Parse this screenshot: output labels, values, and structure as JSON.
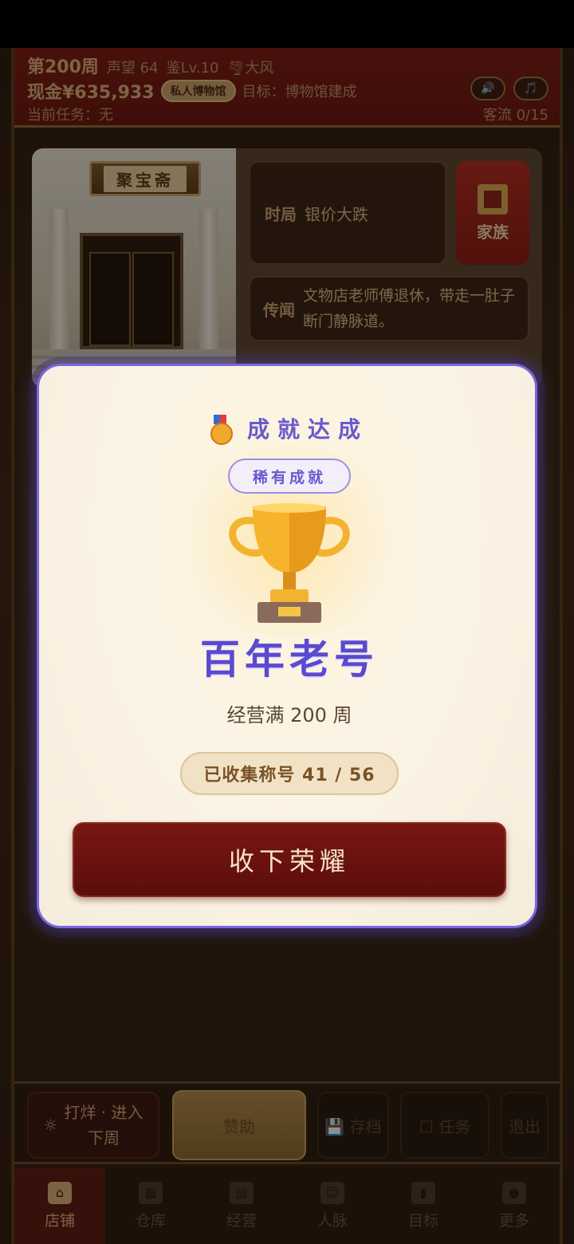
{
  "header": {
    "week": "第200周",
    "prestige": "声望 64",
    "appraisal_level": "鉴Lv.10",
    "weather": "🌪大风",
    "cash": "现金¥635,933",
    "badge": "私人博物馆",
    "goal": "目标：博物馆建成",
    "current_task": "当前任务：无",
    "visitors": "客流 0/15",
    "sound_icon": "🔊",
    "music_icon": "🎵"
  },
  "scene": {
    "shop_sign": "聚宝斋",
    "situation_key": "时局",
    "situation_value": "银价大跌",
    "rumor_key": "传闻",
    "rumor_value": "文物店老师傅退休，带走一肚子断门静脉道。",
    "family_label": "家族"
  },
  "modal": {
    "title": "成就达成",
    "rarity": "稀有成就",
    "achievement_name": "百年老号",
    "achievement_desc": "经营满 200 周",
    "collection_progress": "已收集称号 41 / 56",
    "confirm_label": "收下荣耀"
  },
  "actions": {
    "close_shop_line1": "打烊 · 进入",
    "close_shop_line2": "下周",
    "sponsor": "赞助",
    "save": "💾 存档",
    "task": "☐ 任务",
    "exit": "退出"
  },
  "tabs": [
    {
      "label": "店铺",
      "icon": "shop-icon",
      "active": true
    },
    {
      "label": "仓库",
      "icon": "warehouse-icon",
      "active": false
    },
    {
      "label": "经营",
      "icon": "abacus-icon",
      "active": false
    },
    {
      "label": "人脉",
      "icon": "people-icon",
      "active": false
    },
    {
      "label": "目标",
      "icon": "scroll-icon",
      "active": false
    },
    {
      "label": "更多",
      "icon": "more-icon",
      "active": false
    }
  ],
  "colors": {
    "header_red": "#7a1a14",
    "accent_gold": "#d9b07a",
    "modal_purple": "#6a5ad0",
    "button_red": "#6a1210"
  }
}
